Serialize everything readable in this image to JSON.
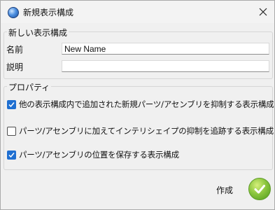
{
  "window": {
    "title": "新規表示構成"
  },
  "new_config_group": {
    "label": "新しい表示構成",
    "name_label": "名前",
    "name_value": "New Name",
    "description_label": "説明",
    "description_value": ""
  },
  "properties_group": {
    "label": "プロパティ",
    "options": [
      {
        "label": "他の表示構成内で追加された新規パーツ/アセンブリを抑制する表示構成",
        "checked": true
      },
      {
        "label": "パーツ/アセンブリに加えてインテリシェイプの抑制を追跡する表示構成",
        "checked": false
      },
      {
        "label": "パーツ/アセンブリの位置を保存する表示構成",
        "checked": true
      }
    ]
  },
  "footer": {
    "create_label": "作成"
  },
  "colors": {
    "accent": "#1f6fd1",
    "ok_green": "#8cc63f"
  },
  "icons": {
    "app": "sphere-icon",
    "close": "close-icon",
    "ok": "checkmark-icon"
  }
}
